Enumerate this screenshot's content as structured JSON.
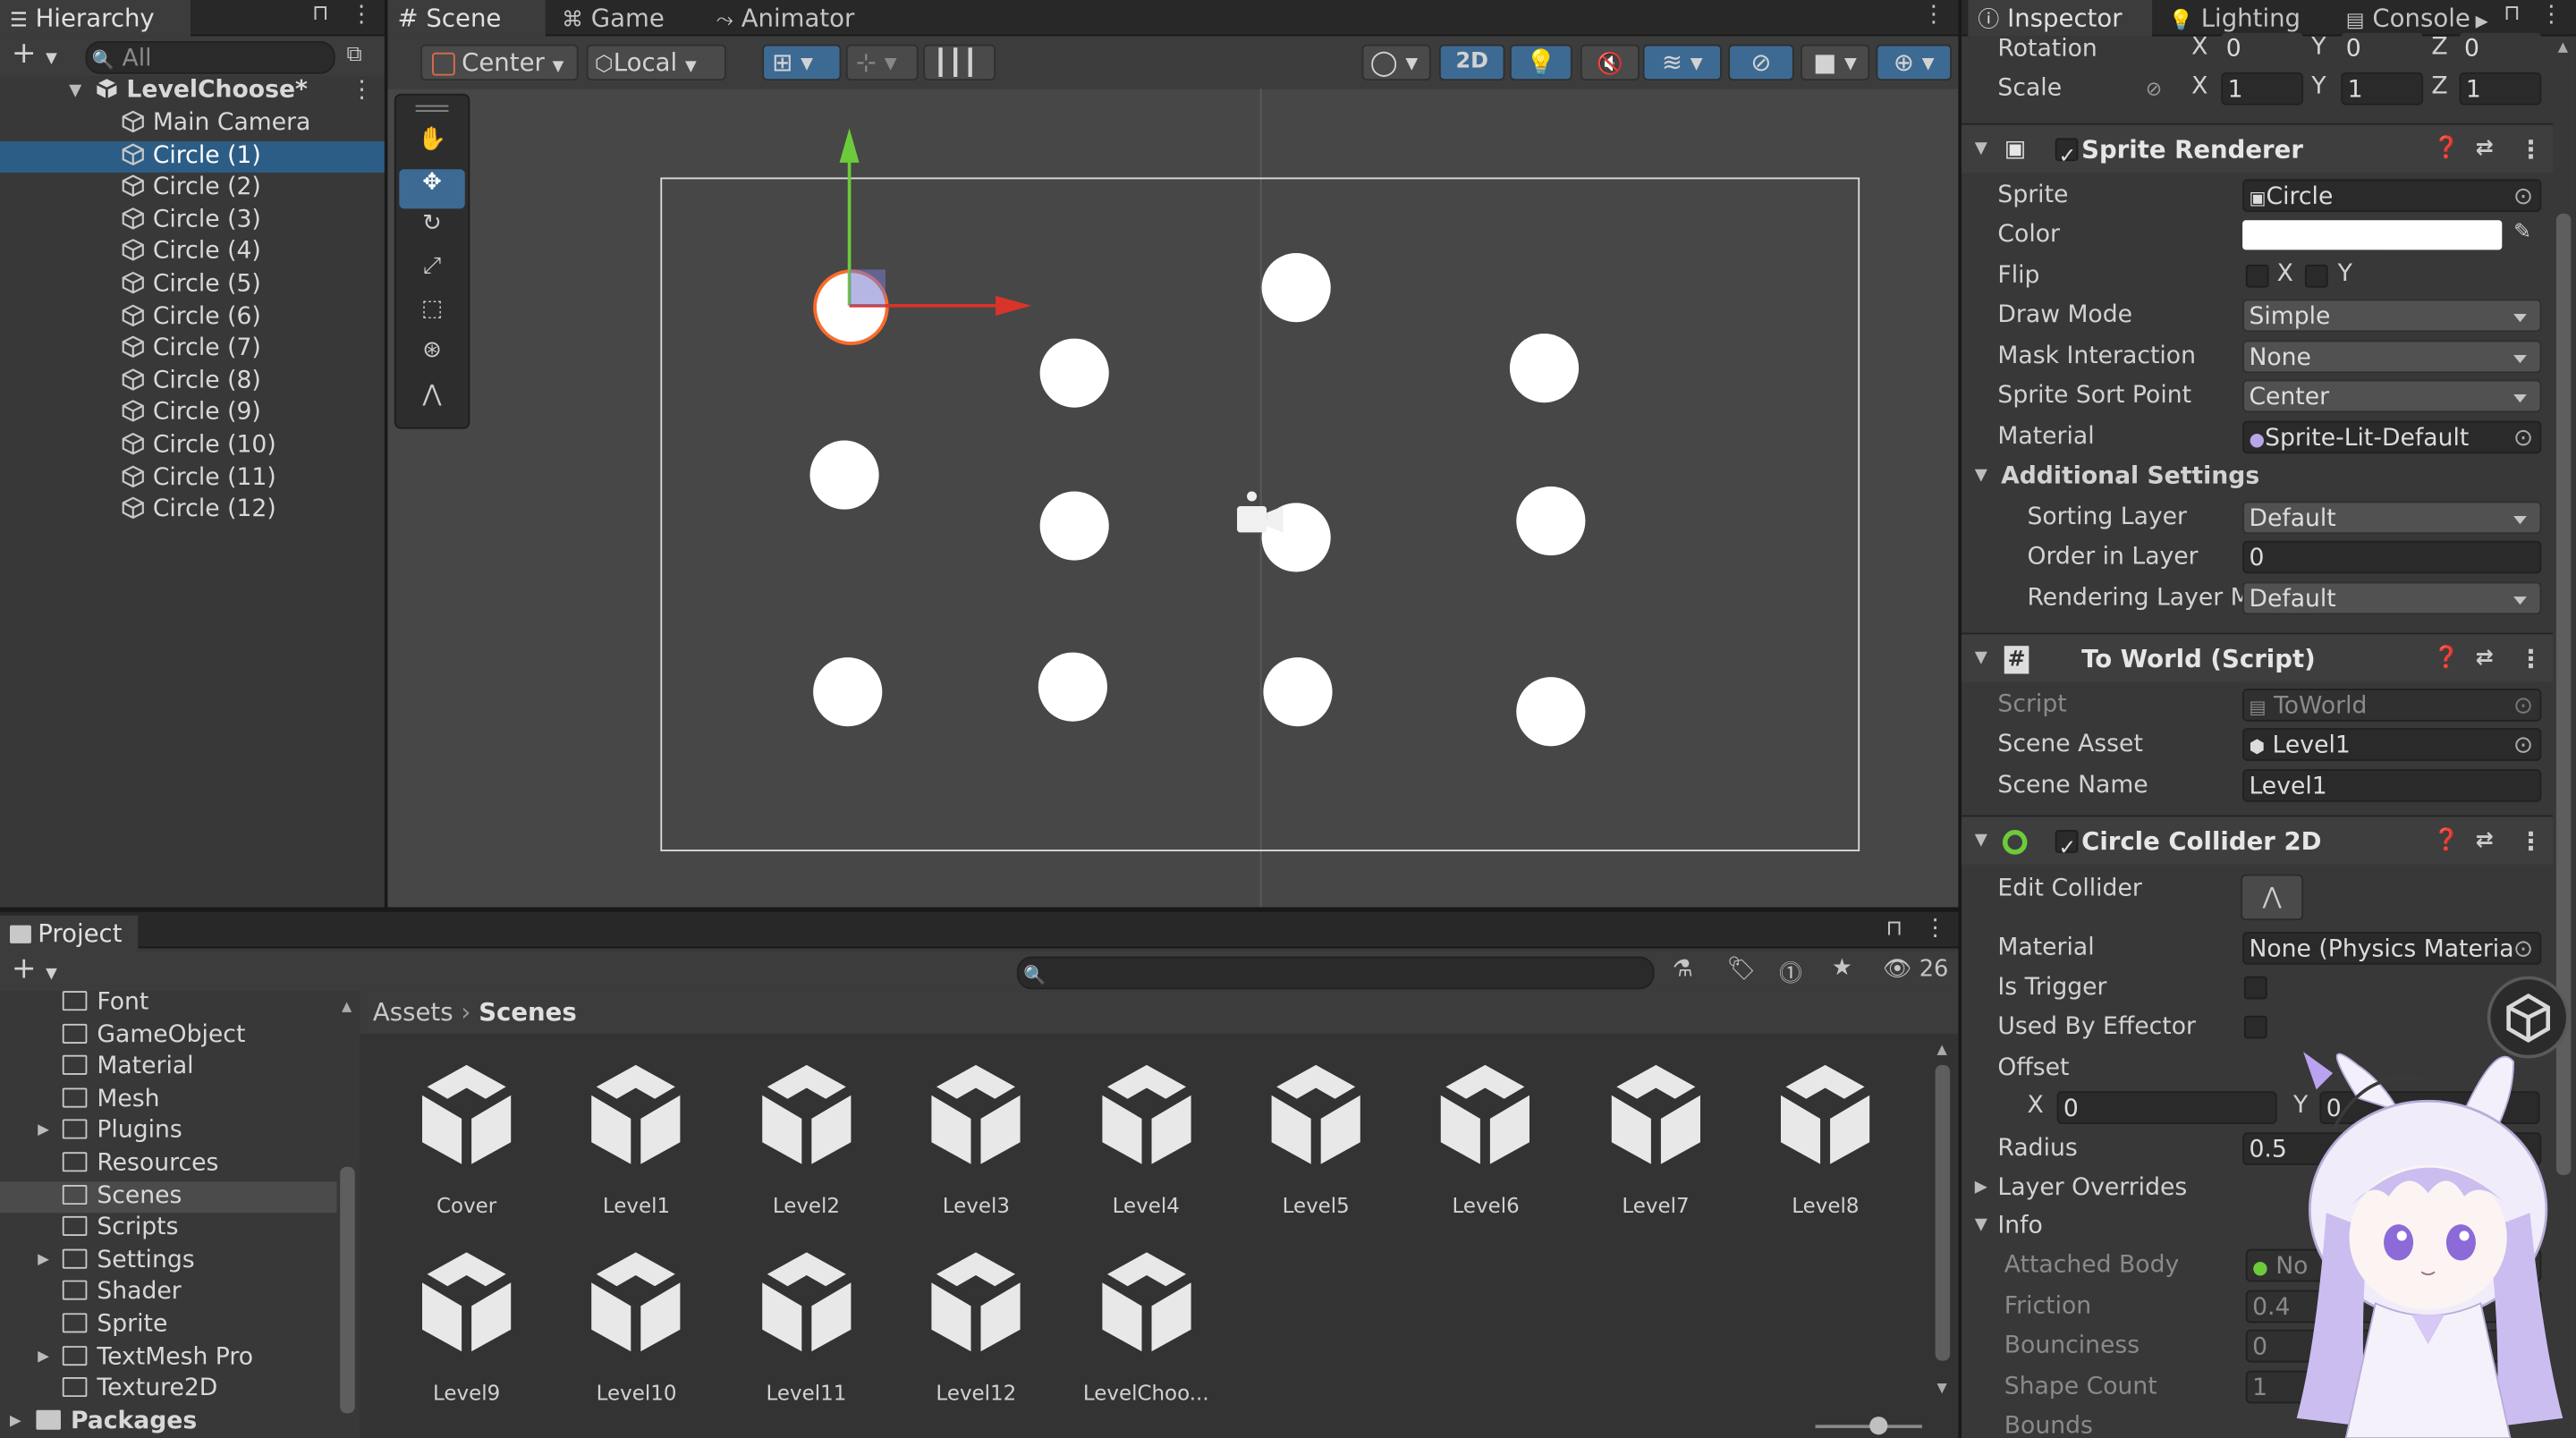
{
  "hierarchy": {
    "tab": "Hierarchy",
    "search_placeholder": "All",
    "scene": "LevelChoose*",
    "items": [
      "Main Camera",
      "Circle (1)",
      "Circle (2)",
      "Circle (3)",
      "Circle (4)",
      "Circle (5)",
      "Circle (6)",
      "Circle (7)",
      "Circle (8)",
      "Circle (9)",
      "Circle (10)",
      "Circle (11)",
      "Circle (12)"
    ],
    "selected": "Circle (1)"
  },
  "scene_view": {
    "tabs": [
      "Scene",
      "Game",
      "Animator"
    ],
    "active_tab": "Scene",
    "pivot": "Center",
    "space": "Local",
    "mode_2d": "2D"
  },
  "project": {
    "tab": "Project",
    "folders": [
      "Font",
      "GameObject",
      "Material",
      "Mesh",
      "Plugins",
      "Resources",
      "Scenes",
      "Scripts",
      "Settings",
      "Shader",
      "Sprite",
      "TextMesh Pro",
      "Texture2D"
    ],
    "selected_folder": "Scenes",
    "packages": "Packages",
    "breadcrumb": [
      "Assets",
      "Scenes"
    ],
    "visible_count": "26",
    "assets": [
      "Cover",
      "Level1",
      "Level2",
      "Level3",
      "Level4",
      "Level5",
      "Level6",
      "Level7",
      "Level8",
      "Level9",
      "Level10",
      "Level11",
      "Level12",
      "LevelChoo..."
    ]
  },
  "inspector": {
    "tabs": [
      "Inspector",
      "Lighting",
      "Console"
    ],
    "transform": {
      "rotation_label": "Rotation",
      "rotation": {
        "x": "0",
        "y": "0",
        "z": "0"
      },
      "scale_label": "Scale",
      "scale": {
        "x": "1",
        "y": "1",
        "z": "1"
      }
    },
    "sprite_renderer": {
      "title": "Sprite Renderer",
      "sprite_label": "Sprite",
      "sprite": "Circle",
      "color_label": "Color",
      "color": "#ffffff",
      "flip_label": "Flip",
      "flip_x": "X",
      "flip_y": "Y",
      "draw_mode_label": "Draw Mode",
      "draw_mode": "Simple",
      "mask_label": "Mask Interaction",
      "mask": "None",
      "sort_point_label": "Sprite Sort Point",
      "sort_point": "Center",
      "material_label": "Material",
      "material": "Sprite-Lit-Default",
      "additional": "Additional Settings",
      "sorting_layer_label": "Sorting Layer",
      "sorting_layer": "Default",
      "order_label": "Order in Layer",
      "order": "0",
      "rendering_label": "Rendering Layer M",
      "rendering": "Default"
    },
    "to_world": {
      "title": "To World (Script)",
      "script_label": "Script",
      "script": "ToWorld",
      "scene_asset_label": "Scene Asset",
      "scene_asset": "Level1",
      "scene_name_label": "Scene Name",
      "scene_name": "Level1"
    },
    "collider": {
      "title": "Circle Collider 2D",
      "edit_label": "Edit Collider",
      "material_label": "Material",
      "material": "None (Physics Materia",
      "trigger_label": "Is Trigger",
      "effector_label": "Used By Effector",
      "offset_label": "Offset",
      "offset_x": "0",
      "offset_y": "0",
      "radius_label": "Radius",
      "radius": "0.5",
      "overrides": "Layer Overrides",
      "info": "Info",
      "attached_label": "Attached Body",
      "attached": "No",
      "friction_label": "Friction",
      "friction": "0.4",
      "bounciness_label": "Bounciness",
      "bounciness": "0",
      "shape_label": "Shape Count",
      "shape": "1",
      "bounds_label": "Bounds"
    }
  },
  "colors": {
    "selection": "#2c5d87",
    "panel": "#383838",
    "accent": "#3d6a93"
  }
}
